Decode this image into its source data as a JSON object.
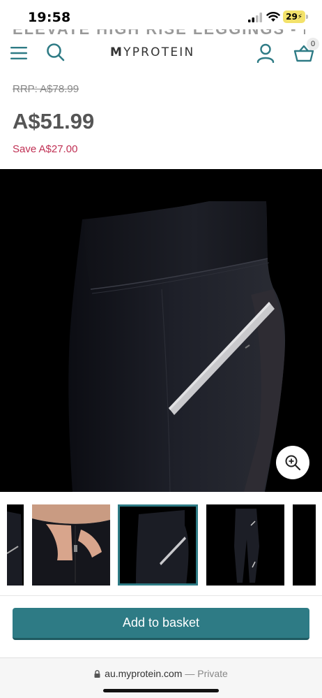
{
  "status": {
    "time": "19:58",
    "battery": "29"
  },
  "header": {
    "logo_prefix": "M",
    "logo_rest": "YPROTEIN",
    "basket_count": "0",
    "ghost_title": "ELEVATE HIGH RISE LEGGINGS - BLACK"
  },
  "pricing": {
    "rrp": "RRP: A$78.99",
    "price": "A$51.99",
    "save": "Save A$27.00"
  },
  "gallery": {
    "thumbnail_count": 5,
    "selected_index": 2
  },
  "actions": {
    "add_to_basket": "Add to basket"
  },
  "browser": {
    "url": "au.myprotein.com",
    "separator": " — ",
    "mode": "Private"
  },
  "colors": {
    "brand_teal": "#2e7b85",
    "save_red": "#c03054"
  }
}
